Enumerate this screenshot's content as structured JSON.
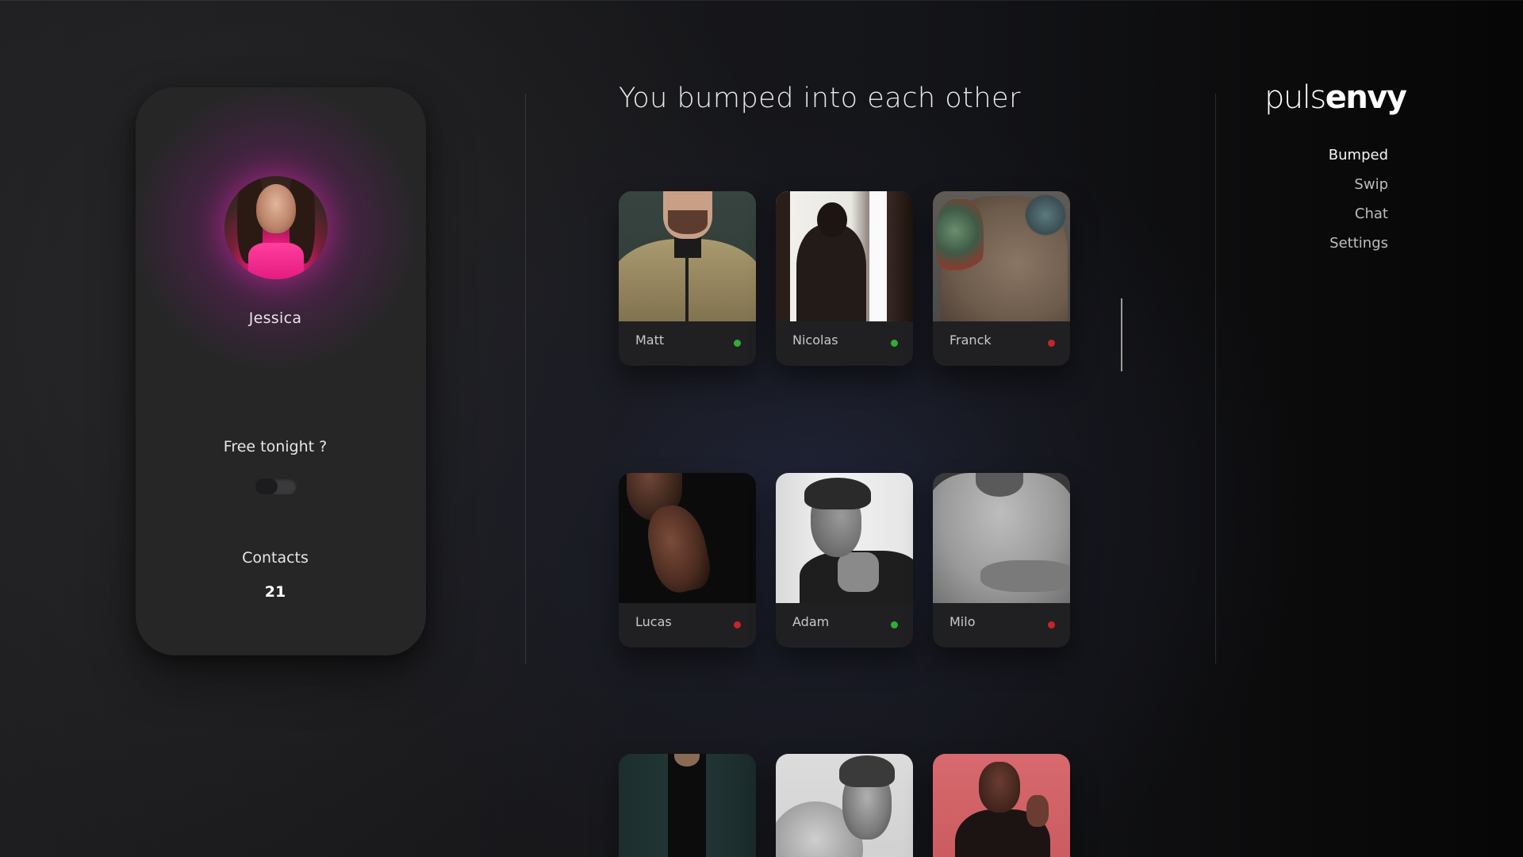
{
  "profile": {
    "name": "Jessica",
    "free_tonight_label": "Free tonight ?",
    "free_tonight_enabled": false,
    "contacts_label": "Contacts",
    "contacts_count": "21"
  },
  "main": {
    "title": "You bumped into each other",
    "contacts": [
      {
        "name": "Matt",
        "status": "online"
      },
      {
        "name": "Nicolas",
        "status": "online"
      },
      {
        "name": "Franck",
        "status": "offline"
      },
      {
        "name": "Lucas",
        "status": "offline"
      },
      {
        "name": "Adam",
        "status": "online"
      },
      {
        "name": "Milo",
        "status": "offline"
      }
    ]
  },
  "brand": {
    "logo_light": "puls",
    "logo_bold": "envy"
  },
  "nav": {
    "items": [
      {
        "label": "Bumped",
        "active": true
      },
      {
        "label": "Swip",
        "active": false
      },
      {
        "label": "Chat",
        "active": false
      },
      {
        "label": "Settings",
        "active": false
      }
    ]
  },
  "colors": {
    "online": "#2fae38",
    "offline": "#c4252b",
    "avatar_glow": "#aa2896"
  }
}
